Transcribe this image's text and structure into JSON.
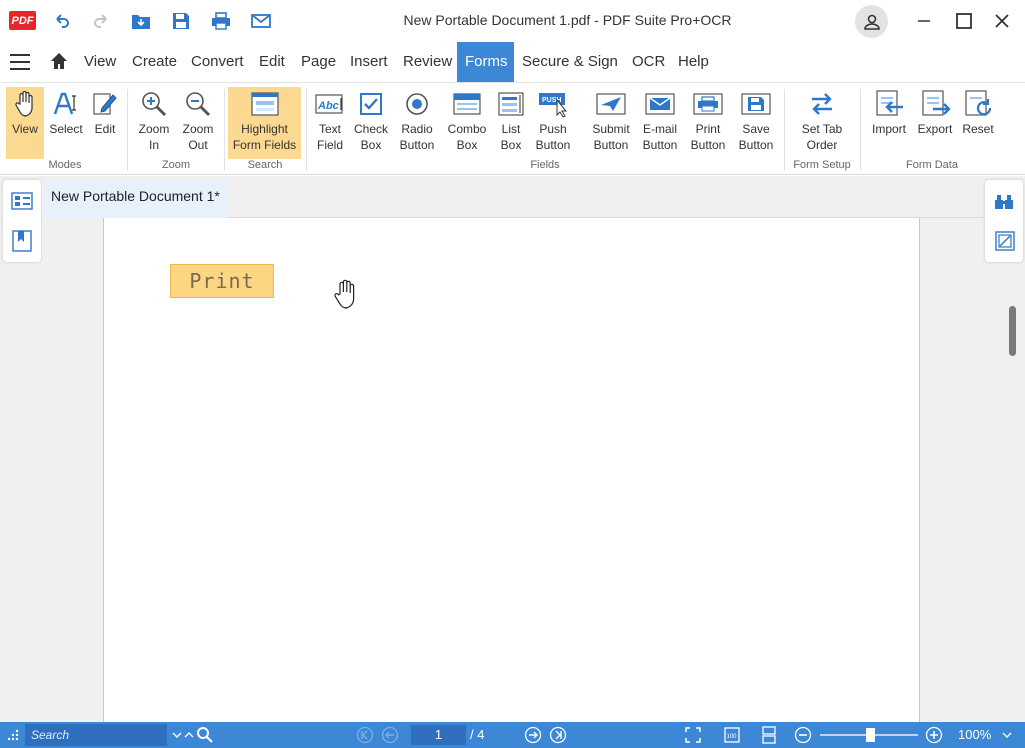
{
  "titlebar": {
    "logo": "PDF",
    "title": "New Portable Document 1.pdf  -  PDF Suite Pro+OCR",
    "icons": [
      "undo-icon",
      "redo-icon",
      "open-folder-icon",
      "save-icon",
      "print-icon",
      "email-icon",
      "user-icon",
      "minimize-icon",
      "maximize-icon",
      "close-icon"
    ]
  },
  "menu": {
    "items": [
      "View",
      "Create",
      "Convert",
      "Edit",
      "Page",
      "Insert",
      "Review",
      "Forms",
      "Secure & Sign",
      "OCR",
      "Help"
    ],
    "active": "Forms"
  },
  "ribbon": {
    "buttons": {
      "view": "View",
      "select": "Select",
      "edit": "Edit",
      "zoom_in": "Zoom\nIn",
      "zoom_out": "Zoom\nOut",
      "highlight": "Highlight\nForm Fields",
      "text_field": "Text\nField",
      "check_box": "Check\nBox",
      "radio_button": "Radio\nButton",
      "combo_box": "Combo\nBox",
      "list_box": "List\nBox",
      "push_button": "Push\nButton",
      "submit_button": "Submit\nButton",
      "email_button": "E-mail\nButton",
      "print_button": "Print\nButton",
      "save_button": "Save\nButton",
      "set_tab_order": "Set Tab\nOrder",
      "import": "Import",
      "export": "Export",
      "reset": "Reset"
    },
    "groups": {
      "modes": "Modes",
      "zoom": "Zoom",
      "search": "Search",
      "fields": "Fields",
      "form_setup": "Form Setup",
      "form_data": "Form Data"
    },
    "icon_text": {
      "text_field": "Abc",
      "push": "PUSH"
    }
  },
  "document": {
    "tab_title": "New Portable Document 1*",
    "print_field_label": "Print"
  },
  "statusbar": {
    "search_placeholder": "Search",
    "current_page": "1",
    "page_total": "/ 4",
    "zoom": "100%",
    "zoom_level_percent": 100,
    "zoom_badge": "100"
  },
  "colors": {
    "accent": "#3c87d6",
    "active_tool": "#fbd990",
    "form_field": "#fdd683",
    "logo_red": "#e8262a"
  }
}
